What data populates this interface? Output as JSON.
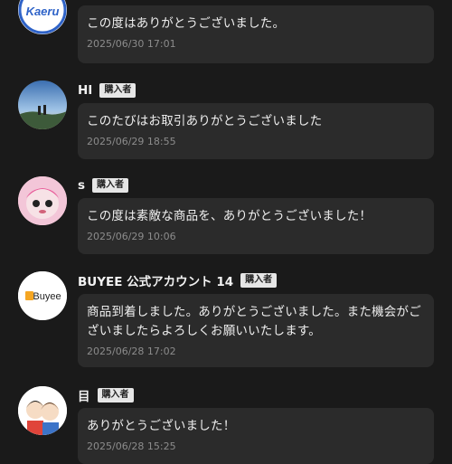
{
  "reviews": [
    {
      "avatar_label": "Kaeru",
      "username": "",
      "badge": "",
      "message": "この度はありがとうございました。",
      "timestamp": "2025/06/30 17:01"
    },
    {
      "avatar_label": "",
      "username": "HI",
      "badge": "購入者",
      "message": "このたびはお取引ありがとうございました",
      "timestamp": "2025/06/29 18:55"
    },
    {
      "avatar_label": "",
      "username": "s",
      "badge": "購入者",
      "message": "この度は素敵な商品を、ありがとうございました！",
      "timestamp": "2025/06/29 10:06"
    },
    {
      "avatar_label": "Buyee",
      "username": "BUYEE 公式アカウント 14",
      "badge": "購入者",
      "message": "商品到着しました。ありがとうございました。また機会がございましたらよろしくお願いいたします。",
      "timestamp": "2025/06/28 17:02"
    },
    {
      "avatar_label": "",
      "username": "目",
      "badge": "購入者",
      "message": "ありがとうございました！",
      "timestamp": "2025/06/28 15:25"
    }
  ],
  "colors": {
    "background": "#1a1a1a",
    "bubble": "#2b2b2b",
    "badge_bg": "#e6e6e6",
    "kaeru_blue": "#2f63c8",
    "buyee_orange": "#f5a623"
  }
}
